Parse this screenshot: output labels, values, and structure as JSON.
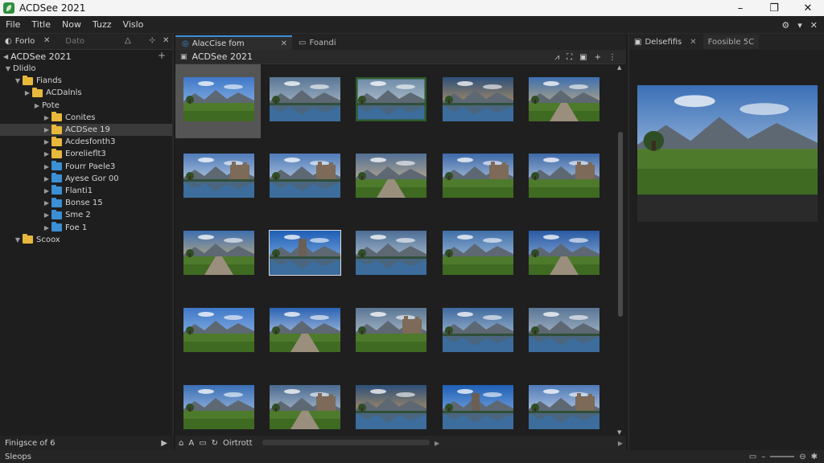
{
  "app": {
    "title": "ACDSee 2021"
  },
  "menu": [
    "File",
    "Title",
    "Now",
    "Tuzz",
    "Vislo"
  ],
  "left": {
    "tabs": [
      "Forlo",
      "Dato"
    ],
    "breadcrumb": "ACDSee 2021",
    "tree": [
      {
        "label": "Dlidlo",
        "indent": 0,
        "arrow": "▼",
        "folder": "none",
        "selected": false
      },
      {
        "label": "Fiands",
        "indent": 1,
        "arrow": "▼",
        "folder": "yellow",
        "selected": false
      },
      {
        "label": "ACDalnls",
        "indent": 2,
        "arrow": "▶",
        "folder": "yellow",
        "selected": false
      },
      {
        "label": "Pote",
        "indent": 3,
        "arrow": "▶",
        "folder": "none",
        "selected": false
      },
      {
        "label": "Conites",
        "indent": 4,
        "arrow": "▶",
        "folder": "yellow",
        "selected": false
      },
      {
        "label": "ACDSee 19",
        "indent": 4,
        "arrow": "▶",
        "folder": "yellow",
        "selected": true
      },
      {
        "label": "Acdesfonth3",
        "indent": 4,
        "arrow": "▶",
        "folder": "yellow",
        "selected": false
      },
      {
        "label": "Eorelieflt3",
        "indent": 4,
        "arrow": "▶",
        "folder": "yellow",
        "selected": false
      },
      {
        "label": "Fourr Paele3",
        "indent": 4,
        "arrow": "▶",
        "folder": "blue",
        "selected": false
      },
      {
        "label": "Ayese Gor 00",
        "indent": 4,
        "arrow": "▶",
        "folder": "blue",
        "selected": false
      },
      {
        "label": "Flanti1",
        "indent": 4,
        "arrow": "▶",
        "folder": "blue",
        "selected": false
      },
      {
        "label": "Bonse 15",
        "indent": 4,
        "arrow": "▶",
        "folder": "blue",
        "selected": false
      },
      {
        "label": "Sme 2",
        "indent": 4,
        "arrow": "▶",
        "folder": "blue",
        "selected": false
      },
      {
        "label": "Foe 1",
        "indent": 4,
        "arrow": "▶",
        "folder": "blue",
        "selected": false
      },
      {
        "label": "Scoox",
        "indent": 1,
        "arrow": "▼",
        "folder": "yellow",
        "selected": false
      }
    ],
    "status": "Finigsce of 6"
  },
  "center": {
    "tabs": [
      "AlacCise fom",
      "Foandi"
    ],
    "path": "ACDSee 2021",
    "bottom_label": "Oirtrott",
    "thumbs": [
      "meadow",
      "peaks-lake",
      "peaks-lake-framed",
      "sunset-lake",
      "sunset-path",
      "castle-lake",
      "castle-lake",
      "field-road",
      "castle-cliff",
      "castle-cliff",
      "sunset-path",
      "monolith-lake",
      "valley-lake",
      "green-valley",
      "blue-path",
      "meadow",
      "sky-road",
      "castle-valley",
      "canyon-lake",
      "peaks-lake",
      "meadow-peaks",
      "castle-road",
      "sunset-lake",
      "monolith-lake",
      "castle-lake"
    ]
  },
  "right": {
    "tabs": [
      "Delsefifis",
      "Foosible 5C"
    ]
  },
  "statusbar": {
    "left": "Sleops"
  }
}
